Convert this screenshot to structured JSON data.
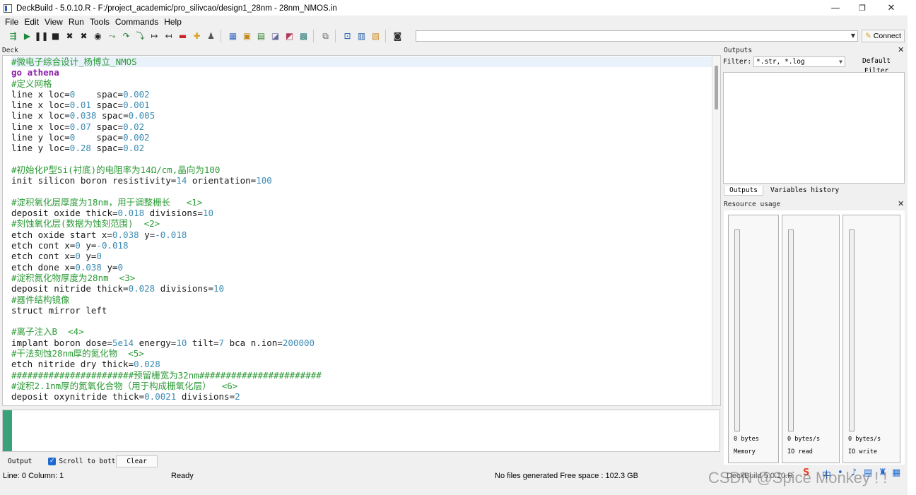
{
  "window": {
    "title": "DeckBuild - 5.0.10.R - F:/project_academic/pro_silivcao/design1_28nm - 28nm_NMOS.in",
    "minimize": "—",
    "maximize": "❐",
    "close": "✕"
  },
  "menu": [
    "File",
    "Edit",
    "View",
    "Run",
    "Tools",
    "Commands",
    "Help"
  ],
  "toolbar": {
    "connect_label": "Connect",
    "icons": [
      "run-start-icon",
      "play-icon",
      "pause-icon",
      "stop-icon",
      "kill-icon",
      "kill-all-icon",
      "record-icon",
      "tool-1-icon",
      "tool-2-icon",
      "tool-3-icon",
      "tool-4-icon",
      "tool-5-icon",
      "tool-6-icon",
      "tool-7-icon",
      "tool-8-icon",
      "plot-1-icon",
      "plot-2-icon",
      "plot-3-icon",
      "plot-4-icon",
      "plot-5-icon",
      "plot-6-icon",
      "windows-icon",
      "var-icon",
      "grid-icon",
      "colormap-icon",
      "camera-icon"
    ]
  },
  "deck": {
    "label": "Deck",
    "lines": [
      [
        {
          "c": "cmt",
          "t": "#微电子综合设计_杨博立_NMOS"
        }
      ],
      [
        {
          "c": "kw",
          "t": "go athena"
        }
      ],
      [
        {
          "c": "cmt",
          "t": "#定义网格"
        }
      ],
      [
        {
          "c": "plain",
          "t": "line x loc="
        },
        {
          "c": "num",
          "t": "0"
        },
        {
          "c": "plain",
          "t": "    spac="
        },
        {
          "c": "num",
          "t": "0.002"
        }
      ],
      [
        {
          "c": "plain",
          "t": "line x loc="
        },
        {
          "c": "num",
          "t": "0.01"
        },
        {
          "c": "plain",
          "t": " spac="
        },
        {
          "c": "num",
          "t": "0.001"
        }
      ],
      [
        {
          "c": "plain",
          "t": "line x loc="
        },
        {
          "c": "num",
          "t": "0.038"
        },
        {
          "c": "plain",
          "t": " spac="
        },
        {
          "c": "num",
          "t": "0.005"
        }
      ],
      [
        {
          "c": "plain",
          "t": "line x loc="
        },
        {
          "c": "num",
          "t": "0.07"
        },
        {
          "c": "plain",
          "t": " spac="
        },
        {
          "c": "num",
          "t": "0.02"
        }
      ],
      [
        {
          "c": "plain",
          "t": "line y loc="
        },
        {
          "c": "num",
          "t": "0"
        },
        {
          "c": "plain",
          "t": "    spac="
        },
        {
          "c": "num",
          "t": "0.002"
        }
      ],
      [
        {
          "c": "plain",
          "t": "line y loc="
        },
        {
          "c": "num",
          "t": "0.28"
        },
        {
          "c": "plain",
          "t": " spac="
        },
        {
          "c": "num",
          "t": "0.02"
        }
      ],
      [],
      [
        {
          "c": "cmt",
          "t": "#初始化P型Si(衬底)的电阻率为14Ω/cm,晶向为100"
        }
      ],
      [
        {
          "c": "plain",
          "t": "init silicon boron resistivity="
        },
        {
          "c": "num",
          "t": "14"
        },
        {
          "c": "plain",
          "t": " orientation="
        },
        {
          "c": "num",
          "t": "100"
        }
      ],
      [],
      [
        {
          "c": "cmt",
          "t": "#淀积氧化层厚度为18nm，用于调整栅长   <1>"
        }
      ],
      [
        {
          "c": "plain",
          "t": "deposit oxide thick="
        },
        {
          "c": "num",
          "t": "0.018"
        },
        {
          "c": "plain",
          "t": " divisions="
        },
        {
          "c": "num",
          "t": "10"
        }
      ],
      [
        {
          "c": "cmt",
          "t": "#刻蚀氧化层(数据为蚀刻范围)  <2>"
        }
      ],
      [
        {
          "c": "plain",
          "t": "etch oxide start x="
        },
        {
          "c": "num",
          "t": "0.038"
        },
        {
          "c": "plain",
          "t": " y="
        },
        {
          "c": "num",
          "t": "-0.018"
        }
      ],
      [
        {
          "c": "plain",
          "t": "etch cont x="
        },
        {
          "c": "num",
          "t": "0"
        },
        {
          "c": "plain",
          "t": " y="
        },
        {
          "c": "num",
          "t": "-0.018"
        }
      ],
      [
        {
          "c": "plain",
          "t": "etch cont x="
        },
        {
          "c": "num",
          "t": "0"
        },
        {
          "c": "plain",
          "t": " y="
        },
        {
          "c": "num",
          "t": "0"
        }
      ],
      [
        {
          "c": "plain",
          "t": "etch done x="
        },
        {
          "c": "num",
          "t": "0.038"
        },
        {
          "c": "plain",
          "t": " y="
        },
        {
          "c": "num",
          "t": "0"
        }
      ],
      [
        {
          "c": "cmt",
          "t": "#淀积氮化物厚度为28nm  <3>"
        }
      ],
      [
        {
          "c": "plain",
          "t": "deposit nitride thick="
        },
        {
          "c": "num",
          "t": "0.028"
        },
        {
          "c": "plain",
          "t": " divisions="
        },
        {
          "c": "num",
          "t": "10"
        }
      ],
      [
        {
          "c": "cmt",
          "t": "#器件结构镜像"
        }
      ],
      [
        {
          "c": "plain",
          "t": "struct mirror left"
        }
      ],
      [],
      [
        {
          "c": "cmt",
          "t": "#离子注入B  <4>"
        }
      ],
      [
        {
          "c": "plain",
          "t": "implant boron dose="
        },
        {
          "c": "num",
          "t": "5e14"
        },
        {
          "c": "plain",
          "t": " energy="
        },
        {
          "c": "num",
          "t": "10"
        },
        {
          "c": "plain",
          "t": " tilt="
        },
        {
          "c": "num",
          "t": "7"
        },
        {
          "c": "plain",
          "t": " bca n.ion="
        },
        {
          "c": "num",
          "t": "200000"
        }
      ],
      [
        {
          "c": "cmt",
          "t": "#干法刻蚀28nm厚的氮化物  <5>"
        }
      ],
      [
        {
          "c": "plain",
          "t": "etch nitride dry thick="
        },
        {
          "c": "num",
          "t": "0.028"
        }
      ],
      [
        {
          "c": "cmt",
          "t": "#######################预留栅宽为32nm#######################"
        }
      ],
      [
        {
          "c": "cmt",
          "t": "#淀积2.1nm厚的氮氧化合物（用于构成栅氧化层）  <6>"
        }
      ],
      [
        {
          "c": "plain",
          "t": "deposit oxynitride thick="
        },
        {
          "c": "num",
          "t": "0.0021"
        },
        {
          "c": "plain",
          "t": " divisions="
        },
        {
          "c": "num",
          "t": "2"
        }
      ]
    ]
  },
  "output_panel": {
    "tab": "Output",
    "scroll_label": "Scroll to bottom",
    "clear_label": "Clear"
  },
  "status": {
    "position": "Line: 0 Column: 1",
    "state": "Ready",
    "files": "No files generated Free space : 102.3 GB",
    "app": "DeckBuild 5.0.10.R"
  },
  "outputs": {
    "title": "Outputs",
    "filter_label": "Filter:",
    "filter_value": "*.str, *.log",
    "default_filter": "Default Filter",
    "tabs": [
      "Outputs",
      "Variables history"
    ]
  },
  "resource": {
    "title": "Resource usage",
    "meters": [
      {
        "value": "0 bytes",
        "name": "Memory"
      },
      {
        "value": "0 bytes/s",
        "name": "IO read"
      },
      {
        "value": "0 bytes/s",
        "name": "IO write"
      }
    ]
  },
  "watermark": "CSDN @Spice Monkey ! !"
}
